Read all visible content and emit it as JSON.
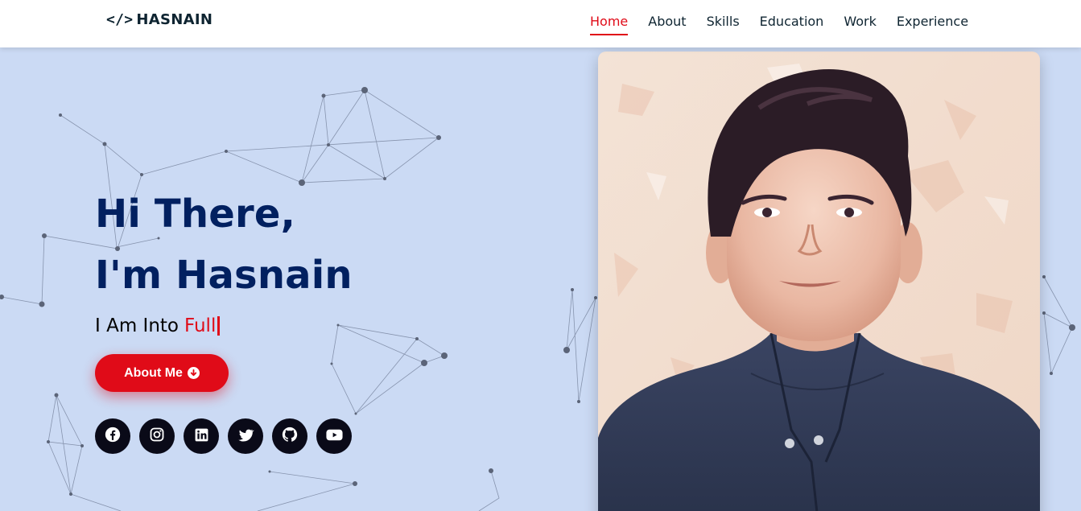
{
  "header": {
    "logo_text": "HASNAIN",
    "logo_icon": "code-icon",
    "nav": [
      {
        "label": "Home",
        "active": true
      },
      {
        "label": "About",
        "active": false
      },
      {
        "label": "Skills",
        "active": false
      },
      {
        "label": "Education",
        "active": false
      },
      {
        "label": "Work",
        "active": false
      },
      {
        "label": "Experience",
        "active": false
      }
    ]
  },
  "hero": {
    "greeting": "Hi There,",
    "name_line": "I'm Hasnain",
    "typed_prefix": "I Am Into",
    "typed_word": "Full",
    "button_label": "About Me",
    "button_icon": "arrow-down-circle-icon"
  },
  "socials": [
    "facebook-icon",
    "instagram-icon",
    "linkedin-icon",
    "twitter-icon",
    "github-icon",
    "youtube-icon"
  ],
  "colors": {
    "accent": "#e00b18",
    "heading": "#012060",
    "background": "#cbdaf4",
    "social_bg": "#0a0a18"
  }
}
